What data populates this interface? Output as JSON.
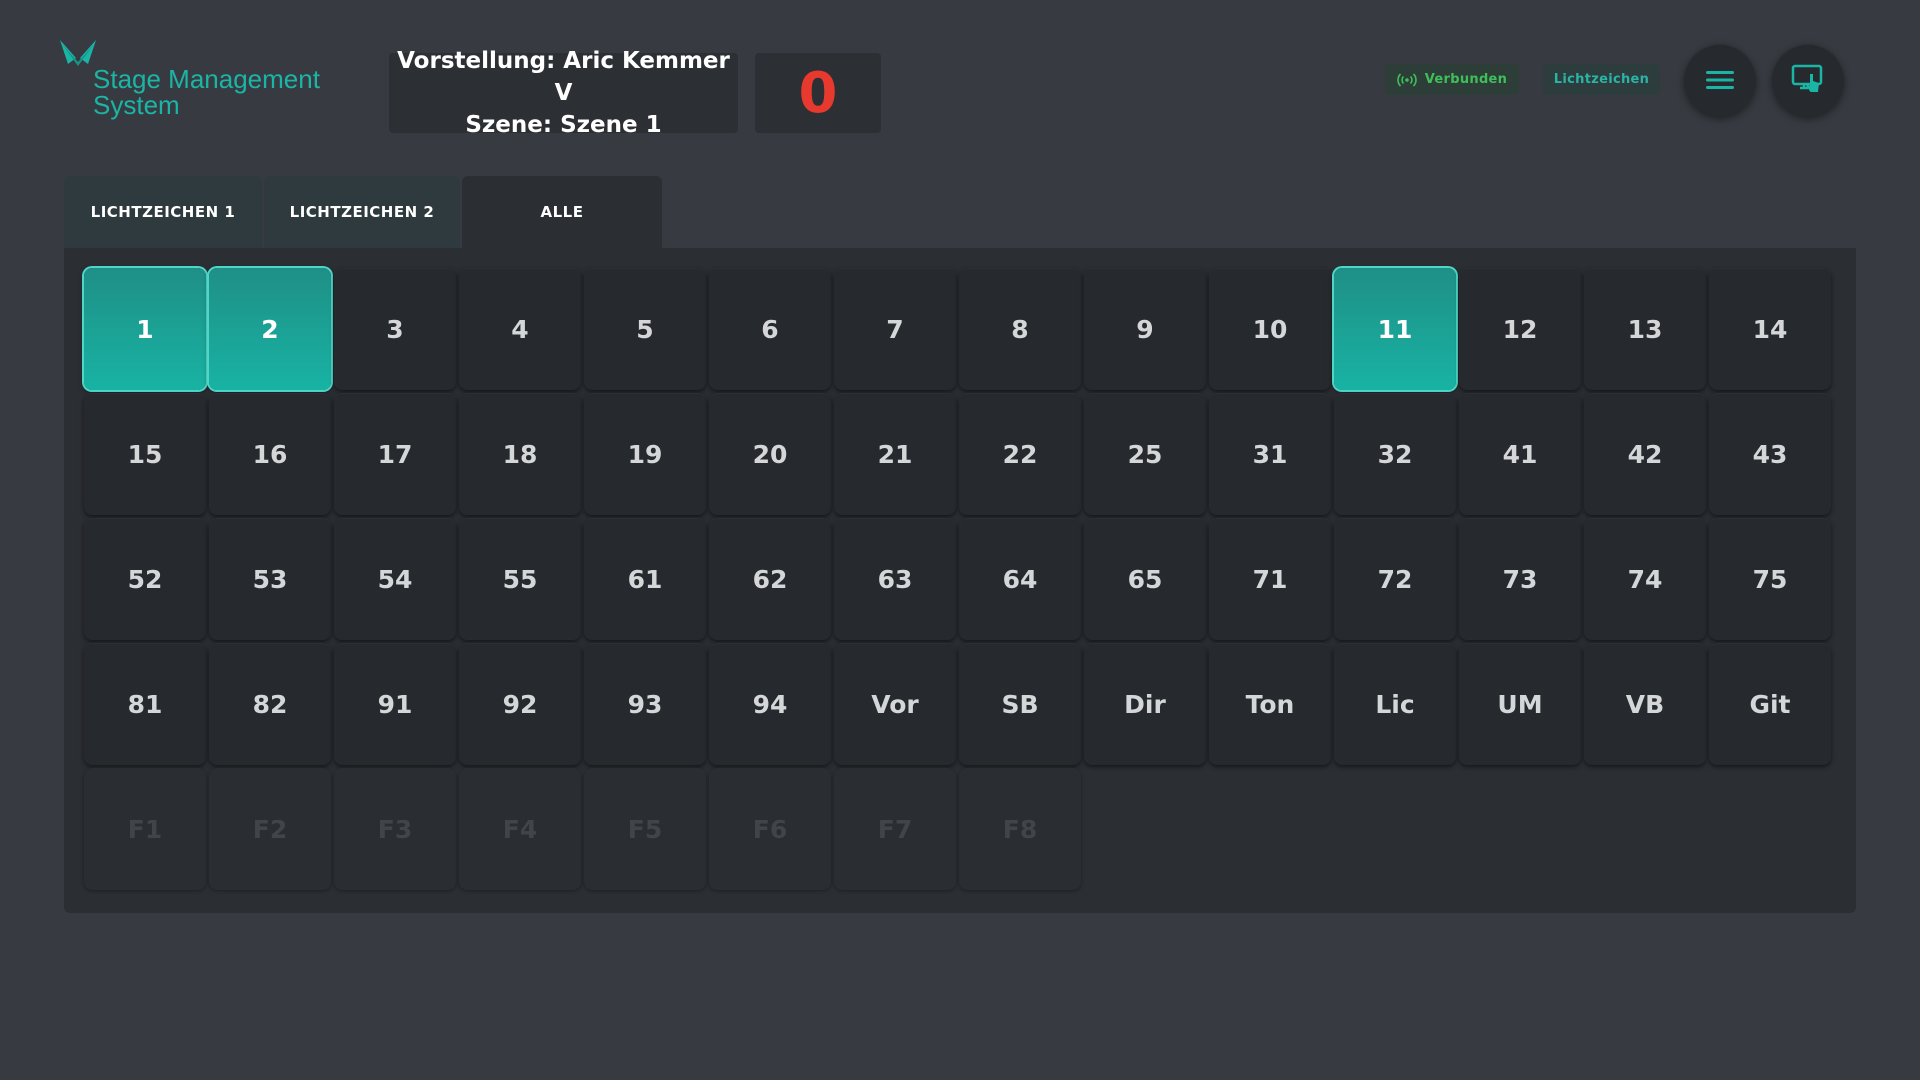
{
  "header": {
    "logo_line1": "Stage Management",
    "logo_line2": "System",
    "show_line": "Vorstellung: Aric Kemmer V",
    "scene_line": "Szene: Szene 1",
    "counter": "0",
    "status_badge": "Verbunden",
    "mode_badge": "Lichtzeichen"
  },
  "icons": {
    "logo": "butterfly-logo-icon",
    "status": "broadcast-icon",
    "menu": "hamburger-menu-icon",
    "touch": "touch-screen-icon"
  },
  "colors": {
    "accent": "#1bb5a6",
    "counter": "#e8392e",
    "connected": "#3fbf5a",
    "background": "#373b41"
  },
  "tabs": [
    {
      "label": "LICHTZEICHEN 1",
      "active": false
    },
    {
      "label": "LICHTZEICHEN 2",
      "active": false
    },
    {
      "label": "ALLE",
      "active": true
    }
  ],
  "cues": [
    {
      "label": "1",
      "state": "selected"
    },
    {
      "label": "2",
      "state": "selected"
    },
    {
      "label": "3",
      "state": "normal"
    },
    {
      "label": "4",
      "state": "normal"
    },
    {
      "label": "5",
      "state": "normal"
    },
    {
      "label": "6",
      "state": "normal"
    },
    {
      "label": "7",
      "state": "normal"
    },
    {
      "label": "8",
      "state": "normal"
    },
    {
      "label": "9",
      "state": "normal"
    },
    {
      "label": "10",
      "state": "normal"
    },
    {
      "label": "11",
      "state": "selected"
    },
    {
      "label": "12",
      "state": "normal"
    },
    {
      "label": "13",
      "state": "normal"
    },
    {
      "label": "14",
      "state": "normal"
    },
    {
      "label": "15",
      "state": "normal"
    },
    {
      "label": "16",
      "state": "normal"
    },
    {
      "label": "17",
      "state": "normal"
    },
    {
      "label": "18",
      "state": "normal"
    },
    {
      "label": "19",
      "state": "normal"
    },
    {
      "label": "20",
      "state": "normal"
    },
    {
      "label": "21",
      "state": "normal"
    },
    {
      "label": "22",
      "state": "normal"
    },
    {
      "label": "25",
      "state": "normal"
    },
    {
      "label": "31",
      "state": "normal"
    },
    {
      "label": "32",
      "state": "normal"
    },
    {
      "label": "41",
      "state": "normal"
    },
    {
      "label": "42",
      "state": "normal"
    },
    {
      "label": "43",
      "state": "normal"
    },
    {
      "label": "52",
      "state": "normal"
    },
    {
      "label": "53",
      "state": "normal"
    },
    {
      "label": "54",
      "state": "normal"
    },
    {
      "label": "55",
      "state": "normal"
    },
    {
      "label": "61",
      "state": "normal"
    },
    {
      "label": "62",
      "state": "normal"
    },
    {
      "label": "63",
      "state": "normal"
    },
    {
      "label": "64",
      "state": "normal"
    },
    {
      "label": "65",
      "state": "normal"
    },
    {
      "label": "71",
      "state": "normal"
    },
    {
      "label": "72",
      "state": "normal"
    },
    {
      "label": "73",
      "state": "normal"
    },
    {
      "label": "74",
      "state": "normal"
    },
    {
      "label": "75",
      "state": "normal"
    },
    {
      "label": "81",
      "state": "normal"
    },
    {
      "label": "82",
      "state": "normal"
    },
    {
      "label": "91",
      "state": "normal"
    },
    {
      "label": "92",
      "state": "normal"
    },
    {
      "label": "93",
      "state": "normal"
    },
    {
      "label": "94",
      "state": "normal"
    },
    {
      "label": "Vor",
      "state": "normal"
    },
    {
      "label": "SB",
      "state": "normal"
    },
    {
      "label": "Dir",
      "state": "normal"
    },
    {
      "label": "Ton",
      "state": "normal"
    },
    {
      "label": "Lic",
      "state": "normal"
    },
    {
      "label": "UM",
      "state": "normal"
    },
    {
      "label": "VB",
      "state": "normal"
    },
    {
      "label": "Git",
      "state": "normal"
    },
    {
      "label": "F1",
      "state": "disabled"
    },
    {
      "label": "F2",
      "state": "disabled"
    },
    {
      "label": "F3",
      "state": "disabled"
    },
    {
      "label": "F4",
      "state": "disabled"
    },
    {
      "label": "F5",
      "state": "disabled"
    },
    {
      "label": "F6",
      "state": "disabled"
    },
    {
      "label": "F7",
      "state": "disabled"
    },
    {
      "label": "F8",
      "state": "disabled"
    }
  ]
}
